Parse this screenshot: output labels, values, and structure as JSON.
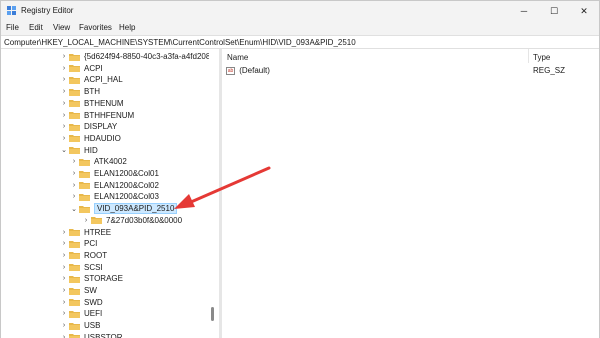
{
  "window": {
    "title": "Registry Editor",
    "minimize": "─",
    "maximize": "☐",
    "close": "✕"
  },
  "menu": [
    "File",
    "Edit",
    "View",
    "Favorites",
    "Help"
  ],
  "address": "Computer\\HKEY_LOCAL_MACHINE\\SYSTEM\\CurrentControlSet\\Enum\\HID\\VID_093A&PID_2510",
  "tree": {
    "items": [
      {
        "label": "{5d624f94-8850-40c3-a3fa-a4fd208",
        "level": 0,
        "chevron": "›"
      },
      {
        "label": "ACPI",
        "level": 0,
        "chevron": "›"
      },
      {
        "label": "ACPI_HAL",
        "level": 0,
        "chevron": "›"
      },
      {
        "label": "BTH",
        "level": 0,
        "chevron": "›"
      },
      {
        "label": "BTHENUM",
        "level": 0,
        "chevron": "›"
      },
      {
        "label": "BTHHFENUM",
        "level": 0,
        "chevron": "›"
      },
      {
        "label": "DISPLAY",
        "level": 0,
        "chevron": "›"
      },
      {
        "label": "HDAUDIO",
        "level": 0,
        "chevron": "›"
      },
      {
        "label": "HID",
        "level": 0,
        "chevron": "⌄"
      },
      {
        "label": "ATK4002",
        "level": 1,
        "chevron": "›"
      },
      {
        "label": "ELAN1200&Col01",
        "level": 1,
        "chevron": "›"
      },
      {
        "label": "ELAN1200&Col02",
        "level": 1,
        "chevron": "›"
      },
      {
        "label": "ELAN1200&Col03",
        "level": 1,
        "chevron": "›"
      },
      {
        "label": "VID_093A&PID_2510",
        "level": 1,
        "chevron": "⌄",
        "selected": true
      },
      {
        "label": "7&27d03b0f&0&0000",
        "level": 2,
        "chevron": "›"
      },
      {
        "label": "HTREE",
        "level": 0,
        "chevron": "›"
      },
      {
        "label": "PCI",
        "level": 0,
        "chevron": "›"
      },
      {
        "label": "ROOT",
        "level": 0,
        "chevron": "›"
      },
      {
        "label": "SCSI",
        "level": 0,
        "chevron": "›"
      },
      {
        "label": "STORAGE",
        "level": 0,
        "chevron": "›"
      },
      {
        "label": "SW",
        "level": 0,
        "chevron": "›"
      },
      {
        "label": "SWD",
        "level": 0,
        "chevron": "›"
      },
      {
        "label": "UEFI",
        "level": 0,
        "chevron": "›"
      },
      {
        "label": "USB",
        "level": 0,
        "chevron": "›"
      },
      {
        "label": "USBSTOR",
        "level": 0,
        "chevron": "›"
      }
    ]
  },
  "list": {
    "headers": {
      "name": "Name",
      "type": "Type"
    },
    "rows": [
      {
        "name": "(Default)",
        "type": "REG_SZ",
        "icon": "ab-string-icon"
      }
    ]
  },
  "colors": {
    "folder": "#e8b84a",
    "selection": "#cce8ff",
    "annotation_arrow": "#e53935"
  }
}
